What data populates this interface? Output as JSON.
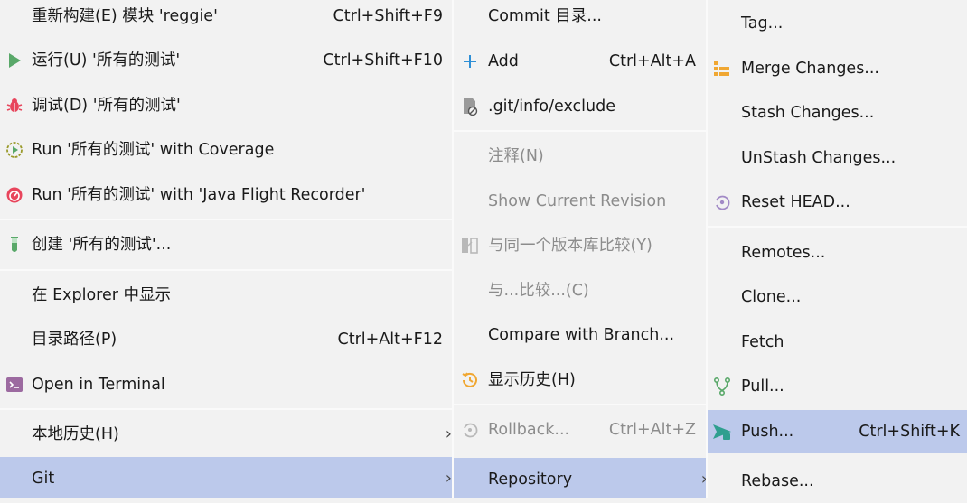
{
  "menu1": {
    "items": [
      {
        "label": "重新构建(E) 模块 'reggie'",
        "shortcut": "Ctrl+Shift+F9",
        "icon": "none"
      },
      {
        "label": "运行(U) '所有的测试'",
        "shortcut": "Ctrl+Shift+F10",
        "icon": "run-icon"
      },
      {
        "label": "调试(D) '所有的测试'",
        "shortcut": "",
        "icon": "debug-icon"
      },
      {
        "label": "Run '所有的测试' with Coverage",
        "shortcut": "",
        "icon": "coverage-icon"
      },
      {
        "label": "Run '所有的测试' with 'Java Flight Recorder'",
        "shortcut": "",
        "icon": "profiler-icon"
      },
      {
        "label": "创建 '所有的测试'...",
        "shortcut": "",
        "icon": "test-tube-icon"
      },
      {
        "label": "在 Explorer 中显示",
        "shortcut": "",
        "icon": "none"
      },
      {
        "label": "目录路径(P)",
        "shortcut": "Ctrl+Alt+F12",
        "icon": "none"
      },
      {
        "label": "Open in Terminal",
        "shortcut": "",
        "icon": "terminal-icon"
      },
      {
        "label": "本地历史(H)",
        "shortcut": "",
        "icon": "none",
        "submenu": "›"
      },
      {
        "label": "Git",
        "shortcut": "",
        "icon": "none",
        "submenu": "›"
      }
    ]
  },
  "menu2": {
    "items": [
      {
        "label": "Commit 目录...",
        "shortcut": "",
        "icon": "none"
      },
      {
        "label": "Add",
        "shortcut": "Ctrl+Alt+A",
        "icon": "add-icon"
      },
      {
        "label": ".git/info/exclude",
        "shortcut": "",
        "icon": "ignore-file-icon"
      },
      {
        "label": "注释(N)",
        "shortcut": "",
        "icon": "none"
      },
      {
        "label": "Show Current Revision",
        "shortcut": "",
        "icon": "none"
      },
      {
        "label": "与同一个版本库比较(Y)",
        "shortcut": "",
        "icon": "compare-icon"
      },
      {
        "label": "与...比较...(C)",
        "shortcut": "",
        "icon": "none"
      },
      {
        "label": "Compare with Branch...",
        "shortcut": "",
        "icon": "none"
      },
      {
        "label": "显示历史(H)",
        "shortcut": "",
        "icon": "history-icon"
      },
      {
        "label": "Rollback...",
        "shortcut": "Ctrl+Alt+Z",
        "icon": "rollback-icon"
      },
      {
        "label": "Repository",
        "shortcut": "",
        "icon": "none",
        "submenu": "›"
      }
    ]
  },
  "menu3": {
    "items": [
      {
        "label": "Tag...",
        "shortcut": "",
        "icon": "none"
      },
      {
        "label": "Merge Changes...",
        "shortcut": "",
        "icon": "merge-icon"
      },
      {
        "label": "Stash Changes...",
        "shortcut": "",
        "icon": "none"
      },
      {
        "label": "UnStash Changes...",
        "shortcut": "",
        "icon": "none"
      },
      {
        "label": "Reset HEAD...",
        "shortcut": "",
        "icon": "reset-icon"
      },
      {
        "label": "Remotes...",
        "shortcut": "",
        "icon": "none"
      },
      {
        "label": "Clone...",
        "shortcut": "",
        "icon": "none"
      },
      {
        "label": "Fetch",
        "shortcut": "",
        "icon": "none"
      },
      {
        "label": "Pull...",
        "shortcut": "",
        "icon": "pull-icon"
      },
      {
        "label": "Push...",
        "shortcut": "Ctrl+Shift+K",
        "icon": "push-icon"
      },
      {
        "label": "Rebase...",
        "shortcut": "",
        "icon": "none"
      }
    ]
  },
  "colors": {
    "background": "#f2f2f2",
    "selected": "#bcc9eb",
    "disabled_text": "#8c8c8c",
    "run_green": "#59a869",
    "debug_red": "#e8455c",
    "merge_orange": "#f0a732",
    "push_teal": "#2f9f8f"
  }
}
